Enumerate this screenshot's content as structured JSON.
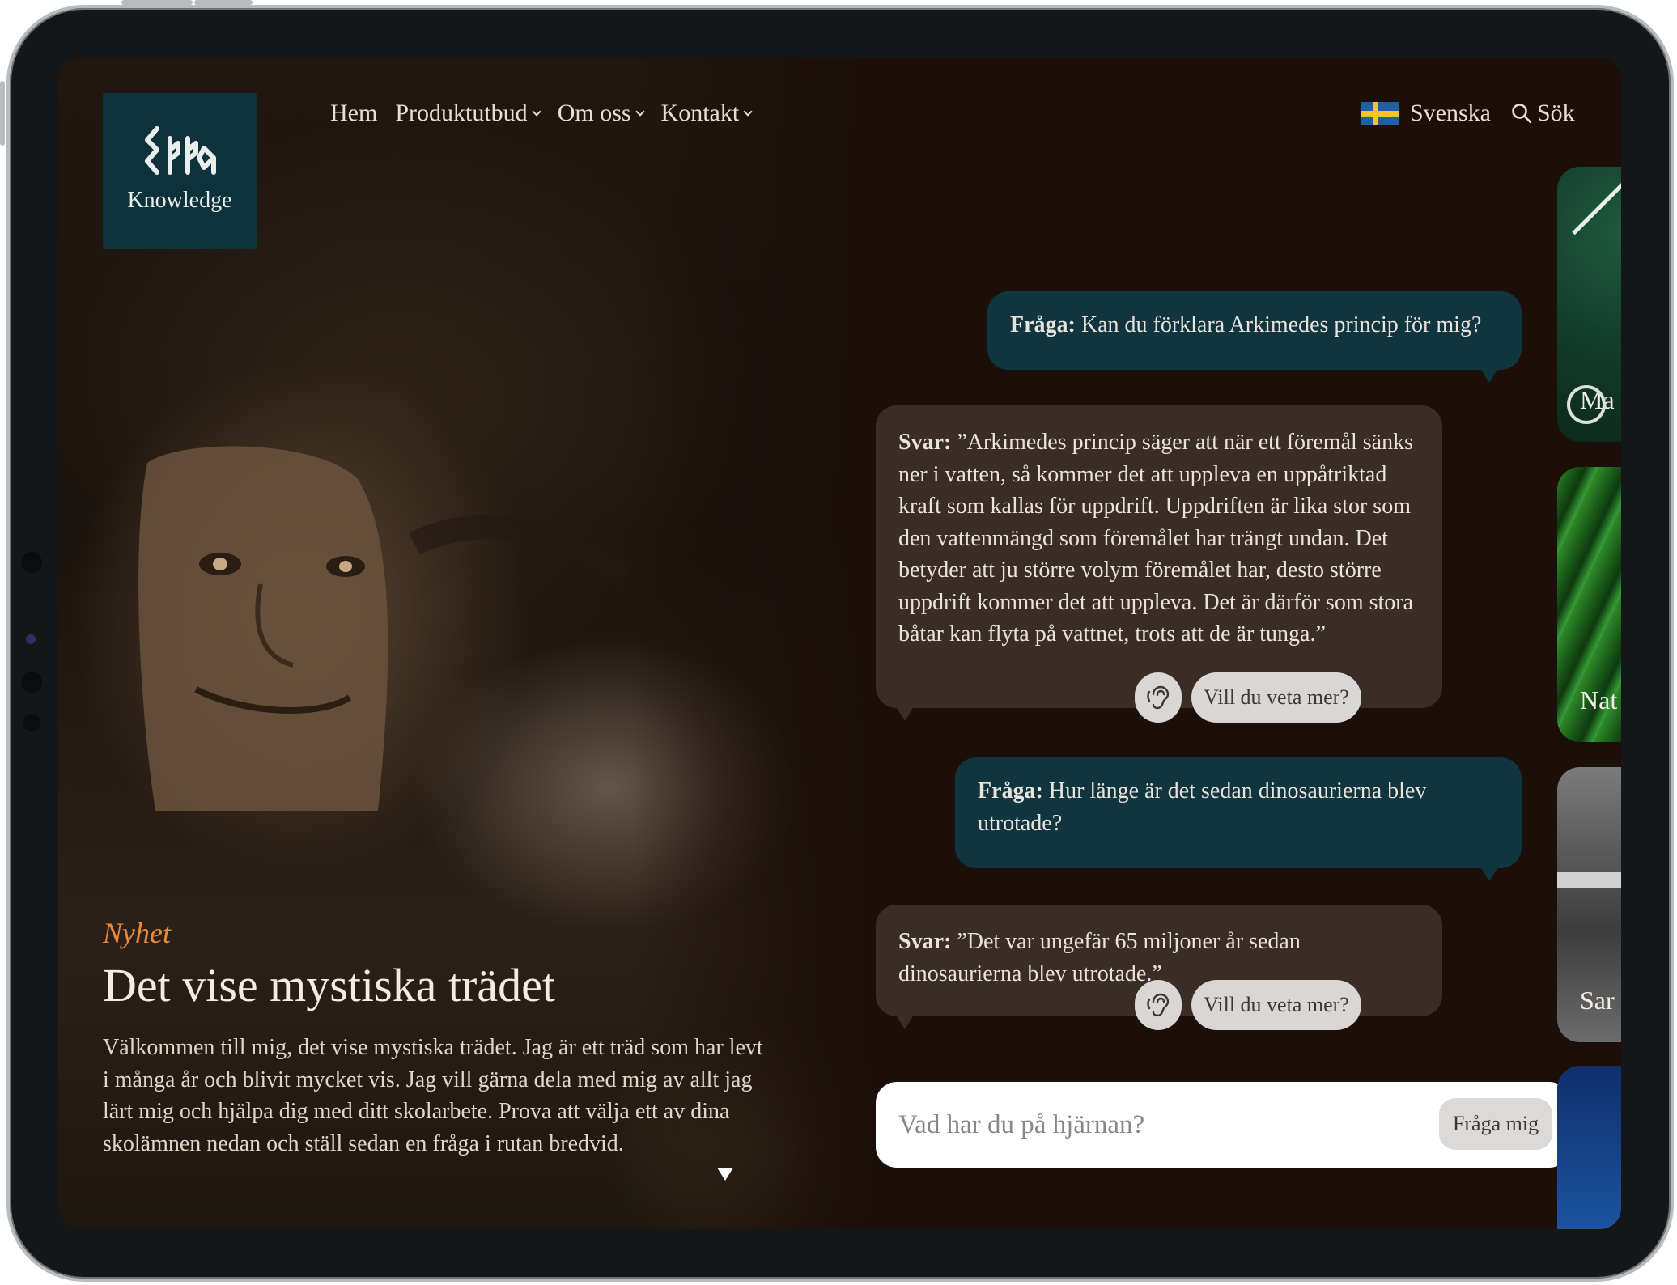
{
  "site": {
    "logo_runes": "ᛈᛞᛞᚪ",
    "logo_text": "Knowledge"
  },
  "nav": {
    "items": [
      {
        "label": "Hem",
        "has_dropdown": false
      },
      {
        "label": "Produktutbud",
        "has_dropdown": true
      },
      {
        "label": "Om oss",
        "has_dropdown": true
      },
      {
        "label": "Kontakt",
        "has_dropdown": true
      }
    ],
    "language": "Svenska",
    "search": "Sök"
  },
  "hero": {
    "eyebrow": "Nyhet",
    "title": "Det vise mystiska trädet",
    "intro": "Välkommen till mig, det vise mystiska trädet. Jag är ett träd som har levt i många år och blivit mycket vis. Jag vill gärna dela med mig av allt jag lärt mig och hjälpa dig med ditt skolarbete. Prova att välja ett av dina skolämnen nedan och ställ sedan en fråga i rutan bredvid."
  },
  "chat": {
    "question_label": "Fråga:",
    "answer_label": "Svar:",
    "more_label": "Vill du veta mer?",
    "messages": [
      {
        "type": "q",
        "text": "Kan du förklara Arkimedes princip för mig?"
      },
      {
        "type": "a",
        "text": "”Arkimedes princip säger att när ett föremål sänks ner i vatten, så kommer det att uppleva en uppåtriktad kraft som kallas för uppdrift. Uppdriften är lika stor som den vattenmängd som föremålet har trängt undan. Det betyder att ju större volym föremålet har, desto större uppdrift kommer det att uppleva. Det är därför som stora båtar kan flyta på vattnet, trots att de är tunga.”"
      },
      {
        "type": "q",
        "text": "Hur länge är det sedan dinosaurierna blev utrotade?"
      },
      {
        "type": "a",
        "text": "”Det var ungefär 65 miljoner år sedan dinosaurierna blev utrotade.”"
      }
    ],
    "input_placeholder": "Vad har du på hjärnan?",
    "submit_label": "Fråga mig"
  },
  "subject_cards": [
    {
      "label": "Ma"
    },
    {
      "label": "Nat"
    },
    {
      "label": "Sar"
    },
    {
      "label": ""
    }
  ],
  "colors": {
    "logo_bg": "#0e323c",
    "question_bubble": "#10353f",
    "answer_bubble": "#3a2d27",
    "accent_orange": "#e98a3a",
    "page_bg": "#1c0f0a"
  }
}
